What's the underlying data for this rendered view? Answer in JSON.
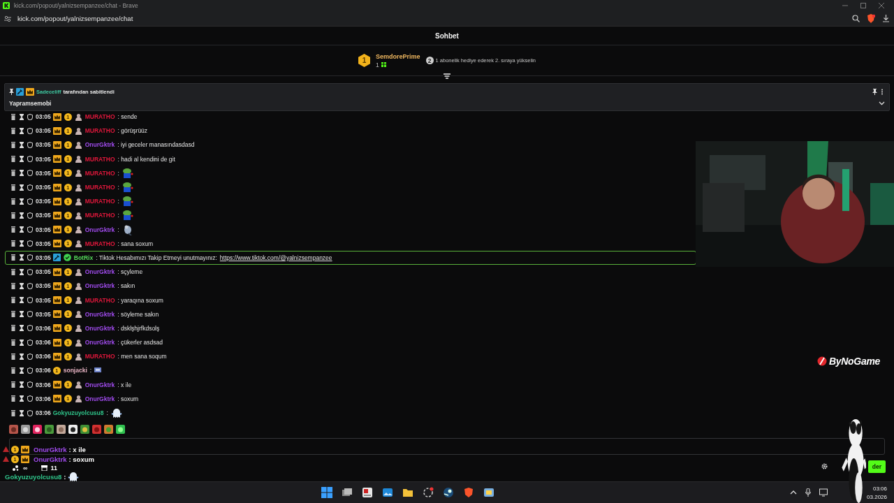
{
  "browser": {
    "title": "kick.com/popout/yalnizsempanzee/chat - Brave",
    "address": "kick.com/popout/yalnizsempanzee/chat"
  },
  "chat": {
    "title": "Sohbet",
    "leaderboard": {
      "rank": "1",
      "user": "SemdorePrime",
      "count": "1",
      "next_rank": "2",
      "hint": "1 abonelik hediye ederek 2. sıraya yükselin"
    },
    "pinned": {
      "by_user": "Sadeceliff",
      "by_text": "tarafından sabitlendi",
      "message": "Yapramsemobi"
    },
    "messages": [
      {
        "time": "03:05",
        "badges": [
          {
            "kind": "crown"
          },
          {
            "kind": "coin",
            "label": "1"
          },
          {
            "kind": "avatar"
          }
        ],
        "user": "MURATHO",
        "color": "#e0173b",
        "text": ": sende",
        "highlighted": false
      },
      {
        "time": "03:05",
        "badges": [
          {
            "kind": "crown"
          },
          {
            "kind": "coin",
            "label": "1"
          },
          {
            "kind": "avatar"
          }
        ],
        "user": "MURATHO",
        "color": "#e0173b",
        "text": ": görüşrüüz",
        "highlighted": false
      },
      {
        "time": "03:05",
        "badges": [
          {
            "kind": "crown"
          },
          {
            "kind": "coin",
            "label": "1"
          },
          {
            "kind": "avatar"
          }
        ],
        "user": "OnurGktrk",
        "color": "#a24cf0",
        "text": ": iyi geceler manasındasdasd",
        "highlighted": false
      },
      {
        "time": "03:05",
        "badges": [
          {
            "kind": "crown"
          },
          {
            "kind": "coin",
            "label": "1"
          },
          {
            "kind": "avatar"
          }
        ],
        "user": "MURATHO",
        "color": "#e0173b",
        "text": ": hadi al kendini de git",
        "highlighted": false
      },
      {
        "time": "03:05",
        "badges": [
          {
            "kind": "crown"
          },
          {
            "kind": "coin",
            "label": "1"
          },
          {
            "kind": "avatar"
          }
        ],
        "user": "MURATHO",
        "color": "#e0173b",
        "text": ":",
        "emote": {
          "kind": "frog"
        },
        "highlighted": false
      },
      {
        "time": "03:05",
        "badges": [
          {
            "kind": "crown"
          },
          {
            "kind": "coin",
            "label": "1"
          },
          {
            "kind": "avatar"
          }
        ],
        "user": "MURATHO",
        "color": "#e0173b",
        "text": ":",
        "emote": {
          "kind": "frog"
        },
        "highlighted": false
      },
      {
        "time": "03:05",
        "badges": [
          {
            "kind": "crown"
          },
          {
            "kind": "coin",
            "label": "1"
          },
          {
            "kind": "avatar"
          }
        ],
        "user": "MURATHO",
        "color": "#e0173b",
        "text": ":",
        "emote": {
          "kind": "frog"
        },
        "highlighted": false
      },
      {
        "time": "03:05",
        "badges": [
          {
            "kind": "crown"
          },
          {
            "kind": "coin",
            "label": "1"
          },
          {
            "kind": "avatar"
          }
        ],
        "user": "MURATHO",
        "color": "#e0173b",
        "text": ":",
        "emote": {
          "kind": "frog"
        },
        "highlighted": false
      },
      {
        "time": "03:05",
        "badges": [
          {
            "kind": "crown"
          },
          {
            "kind": "coin",
            "label": "1"
          },
          {
            "kind": "avatar"
          }
        ],
        "user": "OnurGktrk",
        "color": "#a24cf0",
        "text": ":",
        "emote": {
          "kind": "bird"
        },
        "highlighted": false
      },
      {
        "time": "03:05",
        "badges": [
          {
            "kind": "crown"
          },
          {
            "kind": "coin",
            "label": "1"
          },
          {
            "kind": "avatar"
          }
        ],
        "user": "MURATHO",
        "color": "#e0173b",
        "text": ": sana soxum",
        "highlighted": false
      },
      {
        "time": "03:05",
        "badges": [
          {
            "kind": "mod"
          },
          {
            "kind": "verified"
          }
        ],
        "user": "BotRix",
        "color": "#54d85a",
        "text": ": Tiktok Hesabımızı Takip Etmeyi unutmayınız:",
        "link": "https://www.tiktok.com/@yalnizsempanzee",
        "highlighted": true
      },
      {
        "time": "03:05",
        "badges": [
          {
            "kind": "crown"
          },
          {
            "kind": "coin",
            "label": "1"
          },
          {
            "kind": "avatar"
          }
        ],
        "user": "OnurGktrk",
        "color": "#a24cf0",
        "text": ": sçyleme",
        "highlighted": false
      },
      {
        "time": "03:05",
        "badges": [
          {
            "kind": "crown"
          },
          {
            "kind": "coin",
            "label": "1"
          },
          {
            "kind": "avatar"
          }
        ],
        "user": "OnurGktrk",
        "color": "#a24cf0",
        "text": ": sakın",
        "highlighted": false
      },
      {
        "time": "03:05",
        "badges": [
          {
            "kind": "crown"
          },
          {
            "kind": "coin",
            "label": "1"
          },
          {
            "kind": "avatar"
          }
        ],
        "user": "MURATHO",
        "color": "#e0173b",
        "text": ": yaraqına soxum",
        "highlighted": false
      },
      {
        "time": "03:05",
        "badges": [
          {
            "kind": "crown"
          },
          {
            "kind": "coin",
            "label": "1"
          },
          {
            "kind": "avatar"
          }
        ],
        "user": "OnurGktrk",
        "color": "#a24cf0",
        "text": ": söyleme sakın",
        "highlighted": false
      },
      {
        "time": "03:06",
        "badges": [
          {
            "kind": "crown"
          },
          {
            "kind": "coin",
            "label": "1"
          },
          {
            "kind": "avatar"
          }
        ],
        "user": "OnurGktrk",
        "color": "#a24cf0",
        "text": ": dsklşhjrfkdsolş",
        "highlighted": false
      },
      {
        "time": "03:06",
        "badges": [
          {
            "kind": "crown"
          },
          {
            "kind": "coin",
            "label": "1"
          },
          {
            "kind": "avatar"
          }
        ],
        "user": "OnurGktrk",
        "color": "#a24cf0",
        "text": ": çükerler asdsad",
        "highlighted": false
      },
      {
        "time": "03:06",
        "badges": [
          {
            "kind": "crown"
          },
          {
            "kind": "coin",
            "label": "1"
          },
          {
            "kind": "avatar"
          }
        ],
        "user": "MURATHO",
        "color": "#e0173b",
        "text": ": men sana soqum",
        "highlighted": false
      },
      {
        "time": "03:06",
        "badges": [
          {
            "kind": "coin",
            "label": "1"
          }
        ],
        "user": "sonjacki",
        "color": "#e8b4c4",
        "text": ":",
        "emote": {
          "kind": "flag"
        },
        "highlighted": false
      },
      {
        "time": "03:06",
        "badges": [
          {
            "kind": "crown"
          },
          {
            "kind": "coin",
            "label": "1"
          },
          {
            "kind": "avatar"
          }
        ],
        "user": "OnurGktrk",
        "color": "#a24cf0",
        "text": ": x ile",
        "highlighted": false
      },
      {
        "time": "03:06",
        "badges": [
          {
            "kind": "crown"
          },
          {
            "kind": "coin",
            "label": "1"
          },
          {
            "kind": "avatar"
          }
        ],
        "user": "OnurGktrk",
        "color": "#a24cf0",
        "text": ": soxum",
        "highlighted": false
      },
      {
        "time": "03:06",
        "user": "Gokyuzuyolcusu8",
        "color": "#2fc48a",
        "text": ":",
        "emote": {
          "kind": "ghost"
        },
        "highlighted": false
      }
    ],
    "send_button": "der"
  },
  "overlay": {
    "logo": "ByNoGame",
    "lines": [
      {
        "badges": [
          {
            "kind": "coin",
            "label": "1"
          },
          {
            "kind": "crown"
          }
        ],
        "user": "OnurGktrk",
        "color": "#a24cf0",
        "text": ": x ile"
      },
      {
        "badges": [
          {
            "kind": "coin",
            "label": "1"
          },
          {
            "kind": "crown"
          }
        ],
        "user": "OnurGktrk",
        "color": "#a24cf0",
        "text": ": soxum"
      },
      {
        "user": "Gokyuzuyolcusu8",
        "color": "#2fc48a",
        "text": ":",
        "emote": {
          "kind": "ghost"
        }
      }
    ],
    "stats": {
      "viewers": "∞",
      "count": "11"
    }
  },
  "taskbar": {
    "time": "03:06",
    "date": "03.2026"
  }
}
